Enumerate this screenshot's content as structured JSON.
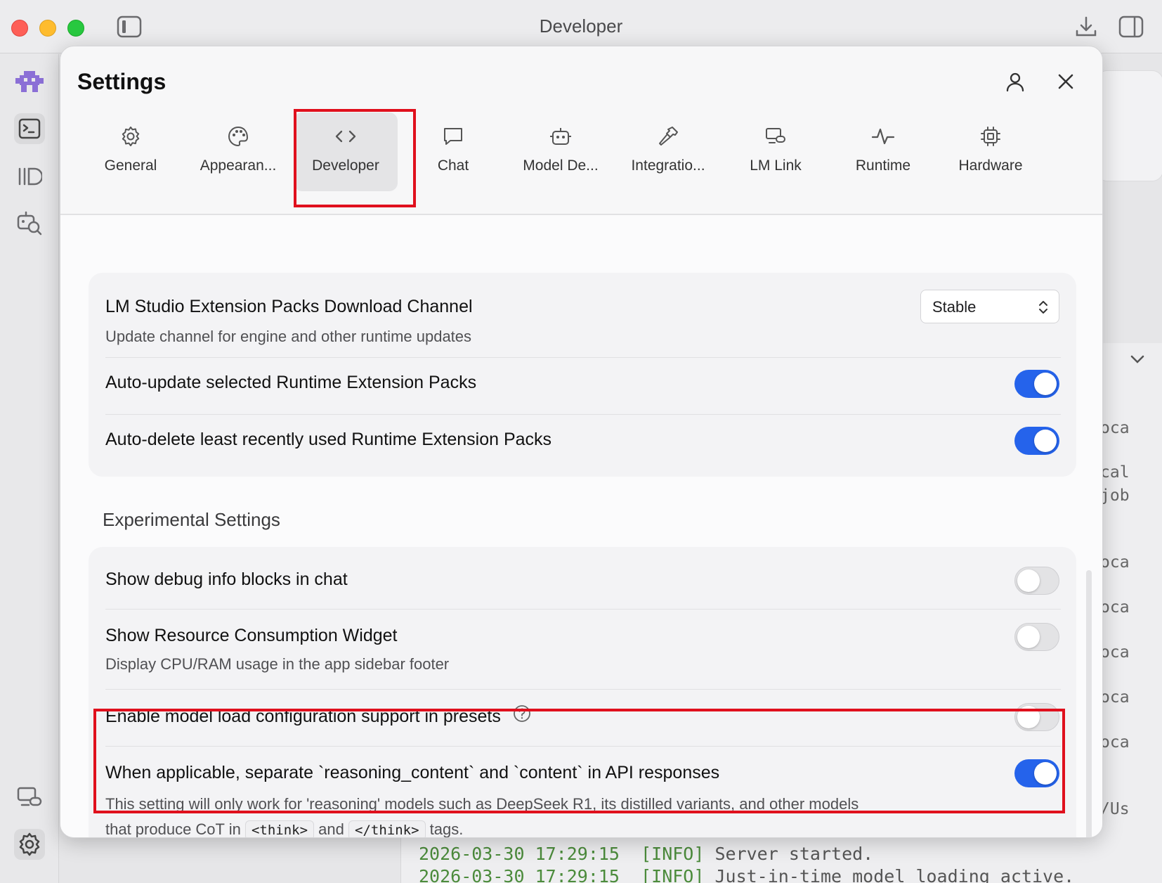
{
  "window": {
    "title": "Developer"
  },
  "background_log": {
    "lines": [
      {
        "timestamp": "2026-03-30 17:29:15",
        "level": "[INFO]",
        "message": "Server started."
      },
      {
        "timestamp": "2026-03-30 17:29:15",
        "level": "[INFO]",
        "message": "Just-in-time model loading active."
      }
    ],
    "fragments": [
      "oca",
      "cal",
      "job",
      "oca",
      "oca",
      "oca",
      "oca",
      "oca",
      "/Us"
    ]
  },
  "settings": {
    "title": "Settings",
    "tabs": [
      {
        "label": "General",
        "icon": "gear-icon"
      },
      {
        "label": "Appearan...",
        "icon": "palette-icon"
      },
      {
        "label": "Developer",
        "icon": "code-icon",
        "active": true
      },
      {
        "label": "Chat",
        "icon": "chat-bubble-icon"
      },
      {
        "label": "Model De...",
        "icon": "robot-icon"
      },
      {
        "label": "Integratio...",
        "icon": "hammer-icon"
      },
      {
        "label": "LM Link",
        "icon": "devices-link-icon"
      },
      {
        "label": "Runtime",
        "icon": "pulse-icon"
      },
      {
        "label": "Hardware",
        "icon": "chip-icon"
      }
    ],
    "runtime_card": {
      "download_channel": {
        "title": "LM Studio Extension Packs Download Channel",
        "subtitle": "Update channel for engine and other runtime updates",
        "value": "Stable"
      },
      "auto_update": {
        "title": "Auto-update selected Runtime Extension Packs",
        "enabled": true
      },
      "auto_delete": {
        "title": "Auto-delete least recently used Runtime Extension Packs",
        "enabled": true
      }
    },
    "experimental": {
      "section_title": "Experimental Settings",
      "debug_info": {
        "title": "Show debug info blocks in chat",
        "enabled": false
      },
      "resource_widget": {
        "title": "Show Resource Consumption Widget",
        "subtitle": "Display CPU/RAM usage in the app sidebar footer",
        "enabled": false
      },
      "model_load_config": {
        "title": "Enable model load configuration support in presets",
        "enabled": false
      },
      "reasoning_separation": {
        "title": "When applicable, separate `reasoning_content` and `content` in API responses",
        "subtitle_part1": "This setting will only work for 'reasoning' models such as DeepSeek R1, its distilled variants, and other models",
        "subtitle_part2": "that produce CoT in",
        "code_open": "<think>",
        "and_word": "and",
        "code_close": "</think>",
        "subtitle_end": "tags.",
        "enabled": true
      }
    }
  },
  "colors": {
    "toggle_on": "#2563eb",
    "highlight": "#e0101d",
    "log_timestamp": "#4b8b3b"
  }
}
